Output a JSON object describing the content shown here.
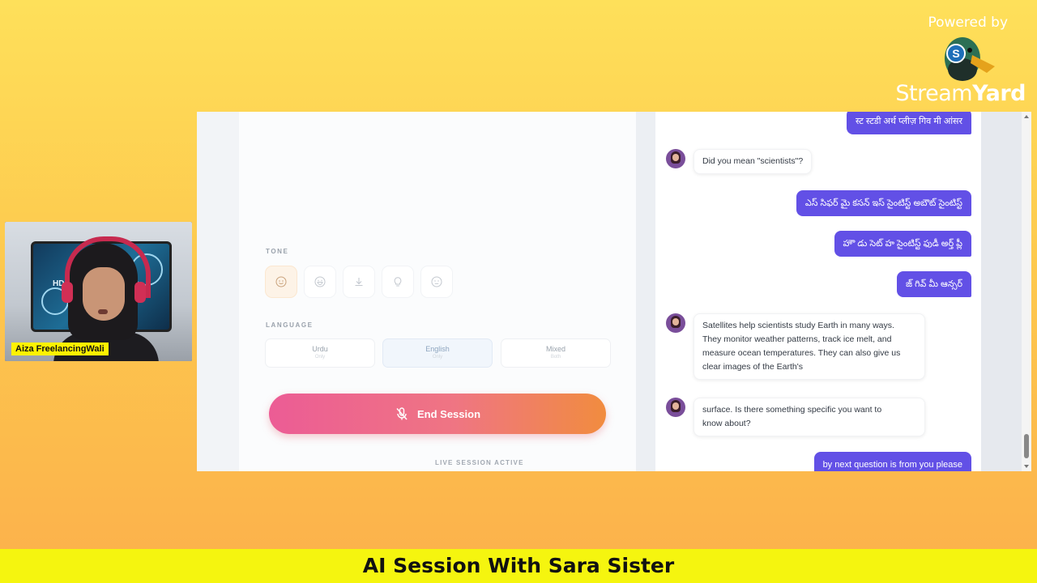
{
  "branding": {
    "powered_by": "Powered by",
    "logo_text_light": "Stream",
    "logo_text_bold": "Yard"
  },
  "camera": {
    "participant_name": "Aiza FreelancingWali",
    "poster_text": "HD"
  },
  "app": {
    "tone": {
      "label": "TONE",
      "icons": [
        "smile-icon",
        "grin-icon",
        "download-icon",
        "lightbulb-icon",
        "neutral-face-icon"
      ],
      "active_index": 0
    },
    "language": {
      "label": "LANGUAGE",
      "options": [
        {
          "name": "Urdu",
          "sub": "Only"
        },
        {
          "name": "English",
          "sub": "Only"
        },
        {
          "name": "Mixed",
          "sub": "Both"
        }
      ],
      "selected": "English"
    },
    "end_session": {
      "label": "End Session",
      "icon": "mic-off-icon"
    },
    "status": "LIVE SESSION ACTIVE",
    "accent_colors": {
      "user_bubble": "#6250e6",
      "end_gradient_start": "#ec5c95",
      "end_gradient_end": "#f18c3f"
    }
  },
  "chat": {
    "messages": [
      {
        "role": "user",
        "text": "स्ट स्टडी अर्थ प्लीज़ गिव मी आंसर"
      },
      {
        "role": "ai",
        "text": "Did you mean \"scientists\"?"
      },
      {
        "role": "user",
        "text": "ఎస్ సిఫర్ మై కసన్ ఇస్ సైంటిస్ట్ అబౌట్ సైంటిస్ట్"
      },
      {
        "role": "user",
        "text": "హౌ డు సెట్ హ సైంటిస్ట్ ఫుడీ అర్త్ ప్లీ"
      },
      {
        "role": "user",
        "text": "జ్ గివ్ మీ ఆన్సర్"
      },
      {
        "role": "ai",
        "lines": [
          "Satellites help scientists study Earth in many ways.",
          "They monitor weather patterns, track ice melt, and",
          "measure ocean temperatures. They can also give us",
          "clear images of the Earth's"
        ]
      },
      {
        "role": "ai",
        "lines": [
          "surface. Is there something specific you want to",
          "know about?"
        ]
      },
      {
        "role": "user",
        "text": "by next question is from you please"
      }
    ]
  },
  "banner": {
    "title": "AI Session With Sara Sister"
  }
}
